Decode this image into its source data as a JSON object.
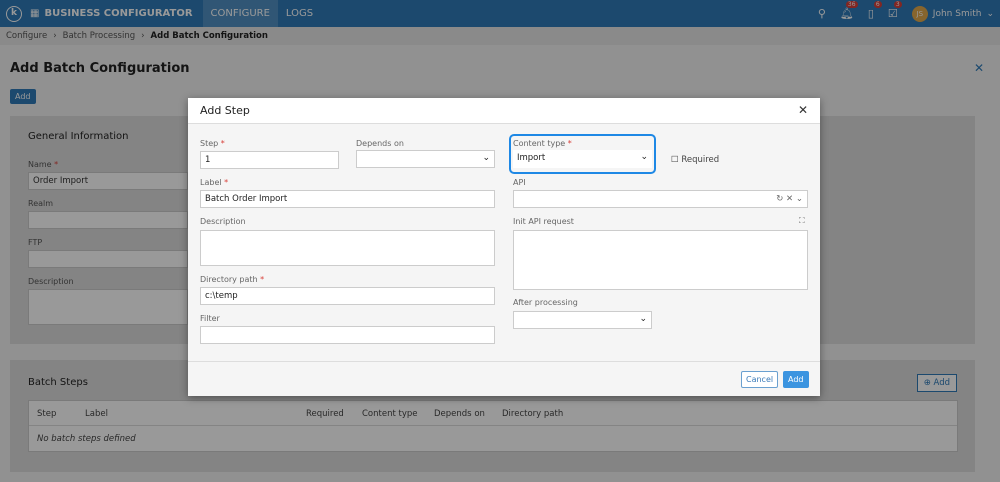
{
  "nav": {
    "brand": "BUSINESS CONFIGURATOR",
    "tabs": [
      "CONFIGURE",
      "LOGS"
    ],
    "badges": {
      "notifications": "36",
      "tasks": "6",
      "approvals": "3"
    },
    "user": "John Smith",
    "initials": "JS",
    "logo": "k"
  },
  "breadcrumb": [
    "Configure",
    "Batch Processing",
    "Add Batch Configuration"
  ],
  "page": {
    "title": "Add Batch Configuration",
    "add": "Add"
  },
  "general": {
    "title": "General Information",
    "name_label": "Name",
    "name": "Order Import",
    "realm": "Realm",
    "ftp": "FTP",
    "description": "Description"
  },
  "steps": {
    "title": "Batch Steps",
    "add": "Add",
    "columns": [
      "Step",
      "Label",
      "Required",
      "Content type",
      "Depends on",
      "Directory path"
    ],
    "empty": "No batch steps defined"
  },
  "modal": {
    "title": "Add Step",
    "step_label": "Step",
    "step": "1",
    "depends_label": "Depends on",
    "content_label": "Content type",
    "content": "Import",
    "required": "Required",
    "label_label": "Label",
    "label": "Batch Order Import",
    "api_label": "API",
    "description_label": "Description",
    "init_label": "Init API request",
    "dir_label": "Directory path",
    "dir": "c:\\temp",
    "after_label": "After processing",
    "filter_label": "Filter",
    "cancel": "Cancel",
    "add": "Add"
  }
}
